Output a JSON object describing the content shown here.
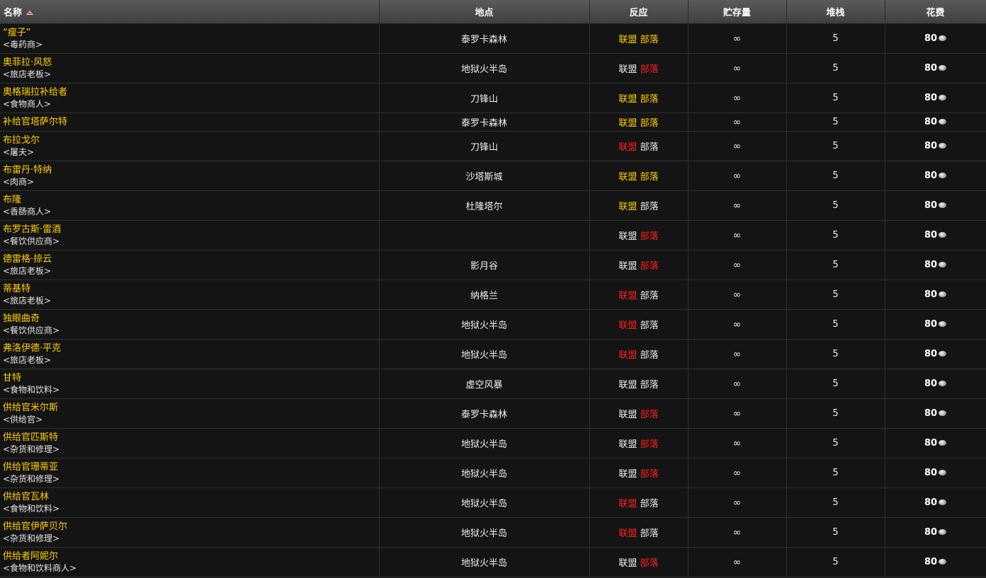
{
  "headers": {
    "name": "名称",
    "location": "地点",
    "reaction": "反应",
    "stock": "贮存量",
    "stack": "堆栈",
    "cost": "花费"
  },
  "reaction_labels": {
    "alliance": "联盟",
    "horde": "部落"
  },
  "reaction_colors": {
    "friendly": "#1eff00",
    "neutral": "#ffd100",
    "hostile": "#ff2020"
  },
  "cost_icon": "silver-coin-icon",
  "rows": [
    {
      "name": "“瘦子”",
      "title": "<毒药商>",
      "location": "泰罗卡森林",
      "alliance": "neutral",
      "horde": "neutral",
      "stock": "∞",
      "stack": "5",
      "cost": "80"
    },
    {
      "name": "奥菲拉·风怒",
      "title": "<旅店老板>",
      "location": "地狱火半岛",
      "alliance": "friendly",
      "horde": "hostile",
      "stock": "∞",
      "stack": "5",
      "cost": "80"
    },
    {
      "name": "奥格瑞拉补给者",
      "title": "<食物商人>",
      "location": "刀锋山",
      "alliance": "neutral",
      "horde": "neutral",
      "stock": "∞",
      "stack": "5",
      "cost": "80"
    },
    {
      "name": "补给官塔萨尔特",
      "title": "",
      "location": "泰罗卡森林",
      "alliance": "neutral",
      "horde": "neutral",
      "stock": "∞",
      "stack": "5",
      "cost": "80"
    },
    {
      "name": "布拉戈尔",
      "title": "<屠夫>",
      "location": "刀锋山",
      "alliance": "hostile",
      "horde": "friendly",
      "stock": "∞",
      "stack": "5",
      "cost": "80"
    },
    {
      "name": "布雷丹·特纳",
      "title": "<肉商>",
      "location": "沙塔斯城",
      "alliance": "neutral",
      "horde": "neutral",
      "stock": "∞",
      "stack": "5",
      "cost": "80"
    },
    {
      "name": "布隆",
      "title": "<香肠商人>",
      "location": "杜隆塔尔",
      "alliance": "neutral",
      "horde": "friendly",
      "stock": "∞",
      "stack": "5",
      "cost": "80"
    },
    {
      "name": "布罗古斯·雷酒",
      "title": "<餐饮供应商>",
      "location": "",
      "alliance": "friendly",
      "horde": "hostile",
      "stock": "∞",
      "stack": "5",
      "cost": "80"
    },
    {
      "name": "德雷格·掠云",
      "title": "<旅店老板>",
      "location": "影月谷",
      "alliance": "friendly",
      "horde": "hostile",
      "stock": "∞",
      "stack": "5",
      "cost": "80"
    },
    {
      "name": "蒂基特",
      "title": "<旅店老板>",
      "location": "纳格兰",
      "alliance": "hostile",
      "horde": "friendly",
      "stock": "∞",
      "stack": "5",
      "cost": "80"
    },
    {
      "name": "独眼曲奇",
      "title": "<餐饮供应商>",
      "location": "地狱火半岛",
      "alliance": "hostile",
      "horde": "friendly",
      "stock": "∞",
      "stack": "5",
      "cost": "80"
    },
    {
      "name": "弗洛伊德·平克",
      "title": "<旅店老板>",
      "location": "地狱火半岛",
      "alliance": "hostile",
      "horde": "friendly",
      "stock": "∞",
      "stack": "5",
      "cost": "80"
    },
    {
      "name": "甘特",
      "title": "<食物和饮料>",
      "location": "虚空风暴",
      "alliance": "friendly",
      "horde": "friendly",
      "stock": "∞",
      "stack": "5",
      "cost": "80"
    },
    {
      "name": "供给官米尔斯",
      "title": "<供给官>",
      "location": "泰罗卡森林",
      "alliance": "friendly",
      "horde": "hostile",
      "stock": "∞",
      "stack": "5",
      "cost": "80"
    },
    {
      "name": "供给官匹斯特",
      "title": "<杂货和修理>",
      "location": "地狱火半岛",
      "alliance": "friendly",
      "horde": "hostile",
      "stock": "∞",
      "stack": "5",
      "cost": "80"
    },
    {
      "name": "供给官珊蒂亚",
      "title": "<杂货和修理>",
      "location": "地狱火半岛",
      "alliance": "friendly",
      "horde": "hostile",
      "stock": "∞",
      "stack": "5",
      "cost": "80"
    },
    {
      "name": "供给官瓦林",
      "title": "<食物和饮料>",
      "location": "地狱火半岛",
      "alliance": "hostile",
      "horde": "friendly",
      "stock": "∞",
      "stack": "5",
      "cost": "80"
    },
    {
      "name": "供给官伊萨贝尔",
      "title": "<杂货和修理>",
      "location": "地狱火半岛",
      "alliance": "hostile",
      "horde": "friendly",
      "stock": "∞",
      "stack": "5",
      "cost": "80"
    },
    {
      "name": "供给者阿妮尔",
      "title": "<食物和饮料商人>",
      "location": "地狱火半岛",
      "alliance": "friendly",
      "horde": "hostile",
      "stock": "∞",
      "stack": "5",
      "cost": "80"
    }
  ]
}
